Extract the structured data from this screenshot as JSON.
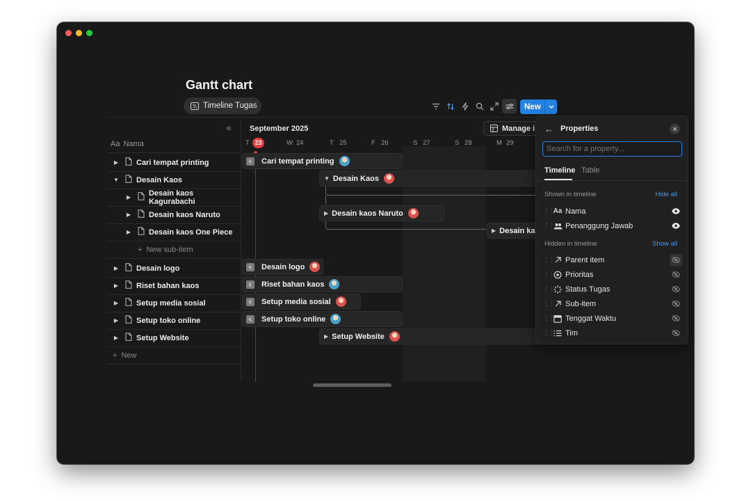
{
  "page": {
    "title": "Gantt chart",
    "view_tab": "Timeline Tugas"
  },
  "toolbar": {
    "new_label": "New",
    "icons": [
      "filter-icon",
      "sort-icon",
      "lightning-icon",
      "search-icon",
      "expand-icon",
      "settings-sliders-icon"
    ]
  },
  "left_panel": {
    "column_header_icon": "Aa",
    "column_header": "Nama",
    "rows": [
      {
        "label": "Cari tempat printing",
        "expanded": false,
        "indent": 0
      },
      {
        "label": "Desain Kaos",
        "expanded": true,
        "indent": 0
      },
      {
        "label": "Desain kaos Kagurabachi",
        "expanded": false,
        "indent": 1
      },
      {
        "label": "Desain kaos Naruto",
        "expanded": false,
        "indent": 1
      },
      {
        "label": "Desain kaos One Piece",
        "expanded": false,
        "indent": 1
      },
      {
        "label": "Desain logo",
        "expanded": false,
        "indent": 0
      },
      {
        "label": "Riset bahan kaos",
        "expanded": false,
        "indent": 0
      },
      {
        "label": "Setup media sosial",
        "expanded": false,
        "indent": 0
      },
      {
        "label": "Setup toko online",
        "expanded": false,
        "indent": 0
      },
      {
        "label": "Setup Website",
        "expanded": false,
        "indent": 0
      }
    ],
    "new_sub_item": "New sub-item",
    "new_item": "New"
  },
  "timeline": {
    "month": "September 2025",
    "days": [
      {
        "dow": "T",
        "num": "23",
        "today": true
      },
      {
        "dow": "W",
        "num": "24"
      },
      {
        "dow": "T",
        "num": "25"
      },
      {
        "dow": "F",
        "num": "26"
      },
      {
        "dow": "S",
        "num": "27"
      },
      {
        "dow": "S",
        "num": "28"
      },
      {
        "dow": "M",
        "num": "29"
      }
    ],
    "manage_button": "Manage i",
    "bars": [
      {
        "label": "Cari tempat printing",
        "avatar_color": "#4aa3c7"
      },
      {
        "label": "Desain Kaos",
        "avatar_color": "#d9534f"
      },
      {
        "label": "Desain kaos Naruto",
        "avatar_color": "#d9534f"
      },
      {
        "label": "Desain kac",
        "avatar_color": ""
      },
      {
        "label": "Desain logo",
        "avatar_color": "#d9534f"
      },
      {
        "label": "Riset bahan kaos",
        "avatar_color": "#4aa3c7"
      },
      {
        "label": "Setup media sosial",
        "avatar_color": "#d9534f"
      },
      {
        "label": "Setup toko online",
        "avatar_color": "#4aa3c7"
      },
      {
        "label": "Setup Website",
        "avatar_color": "#d9534f"
      }
    ]
  },
  "properties_panel": {
    "title": "Properties",
    "search_placeholder": "Search for a property...",
    "tabs": [
      {
        "label": "Timeline",
        "active": true
      },
      {
        "label": "Table",
        "active": false
      }
    ],
    "shown_header": "Shown in timeline",
    "hide_all": "Hide all",
    "shown": [
      {
        "name": "Nama",
        "icon": "text-aa-icon"
      },
      {
        "name": "Penanggung Jawab",
        "icon": "people-icon"
      }
    ],
    "hidden_header": "Hidden in timeline",
    "show_all": "Show all",
    "hidden": [
      {
        "name": "Parent item",
        "icon": "arrow-up-right-icon"
      },
      {
        "name": "Prioritas",
        "icon": "target-icon"
      },
      {
        "name": "Status Tugas",
        "icon": "status-spinner-icon"
      },
      {
        "name": "Sub-item",
        "icon": "arrow-up-right-icon"
      },
      {
        "name": "Tenggat Waktu",
        "icon": "calendar-icon"
      },
      {
        "name": "Tim",
        "icon": "list-icon"
      }
    ]
  },
  "colors": {
    "accent": "#2383e2",
    "today": "#e03e3e",
    "background": "#191919"
  }
}
